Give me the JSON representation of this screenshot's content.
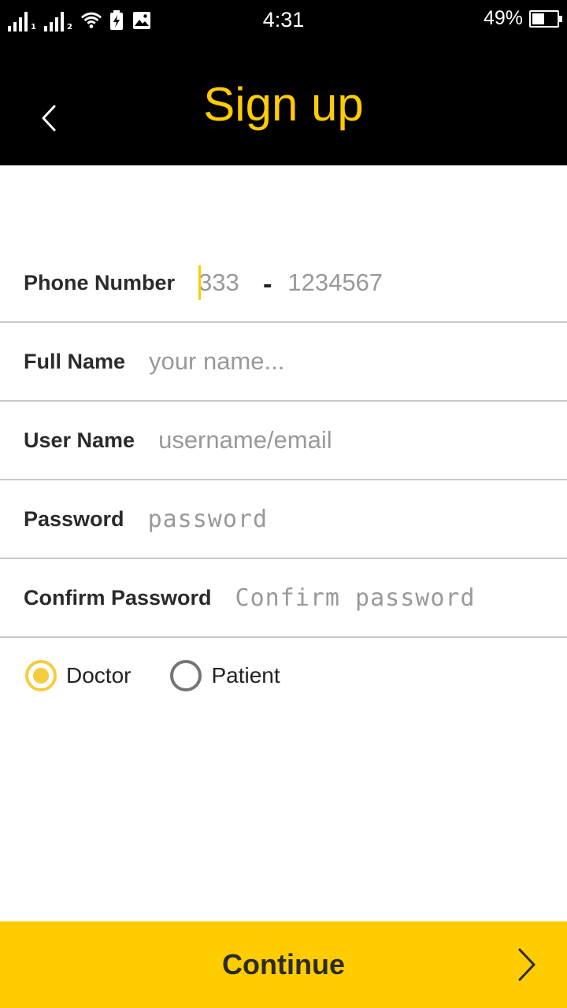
{
  "status_bar": {
    "time": "4:31",
    "battery_percent": "49%",
    "battery_level": 0.49,
    "sim1_label": "1",
    "sim2_label": "2",
    "icons": [
      "signal-icon",
      "signal-icon",
      "wifi-icon",
      "battery-charging-icon",
      "image-icon"
    ]
  },
  "header": {
    "title": "Sign up",
    "back_icon": "chevron-left-icon"
  },
  "form": {
    "phone": {
      "label": "Phone Number",
      "code_placeholder": "333",
      "separator": "-",
      "number_placeholder": "1234567"
    },
    "full_name": {
      "label": "Full Name",
      "placeholder": "your name..."
    },
    "user_name": {
      "label": "User Name",
      "placeholder": "username/email"
    },
    "password": {
      "label": "Password",
      "placeholder": "password"
    },
    "confirm_password": {
      "label": "Confirm Password",
      "placeholder": "Confirm password"
    }
  },
  "role": {
    "options": [
      {
        "label": "Doctor",
        "selected": true
      },
      {
        "label": "Patient",
        "selected": false
      }
    ]
  },
  "footer": {
    "continue_label": "Continue",
    "arrow_icon": "chevron-right-icon"
  },
  "colors": {
    "accent": "#ffcc00",
    "radio_selected": "#f5cc3d",
    "header_bg": "#000000"
  }
}
